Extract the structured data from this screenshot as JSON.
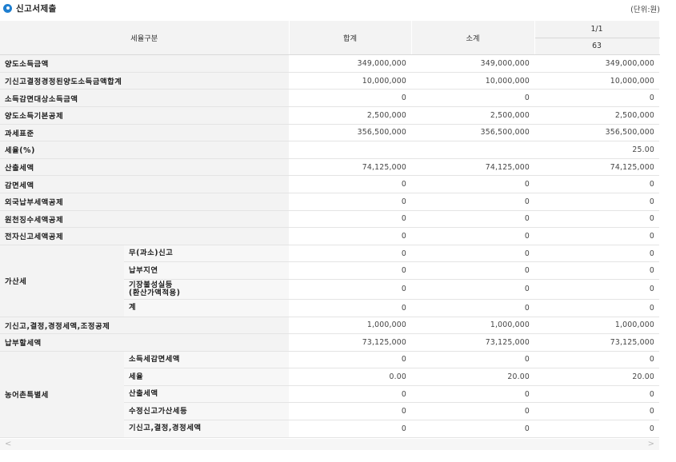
{
  "section": {
    "title": "신고서제출",
    "unit": "(단위:원)"
  },
  "header": {
    "category": "세율구분",
    "total": "합계",
    "subtotal": "소계",
    "period": "1/1",
    "period_sub": "63"
  },
  "rows": {
    "r1": {
      "label": "양도소득금액",
      "total": "349,000,000",
      "sub": "349,000,000",
      "col": "349,000,000"
    },
    "r2": {
      "label": "기신고결정경정된양도소득금액합계",
      "total": "10,000,000",
      "sub": "10,000,000",
      "col": "10,000,000"
    },
    "r3": {
      "label": "소득감면대상소득금액",
      "total": "0",
      "sub": "0",
      "col": "0"
    },
    "r4": {
      "label": "양도소득기본공제",
      "total": "2,500,000",
      "sub": "2,500,000",
      "col": "2,500,000"
    },
    "r5": {
      "label": "과세표준",
      "total": "356,500,000",
      "sub": "356,500,000",
      "col": "356,500,000"
    },
    "r6": {
      "label": "세율(%)",
      "total": "",
      "sub": "",
      "col": "25.00"
    },
    "r7": {
      "label": "산출세액",
      "total": "74,125,000",
      "sub": "74,125,000",
      "col": "74,125,000"
    },
    "r8": {
      "label": "감면세액",
      "total": "0",
      "sub": "0",
      "col": "0"
    },
    "r9": {
      "label": "외국납부세액공제",
      "total": "0",
      "sub": "0",
      "col": "0"
    },
    "r10": {
      "label": "원천징수세액공제",
      "total": "0",
      "sub": "0",
      "col": "0"
    },
    "r11": {
      "label": "전자신고세액공제",
      "total": "0",
      "sub": "0",
      "col": "0"
    },
    "g1": {
      "label": "가산세",
      "s1": {
        "label": "무(과소)신고",
        "total": "0",
        "sub": "0",
        "col": "0"
      },
      "s2": {
        "label": "납부지연",
        "total": "0",
        "sub": "0",
        "col": "0"
      },
      "s3": {
        "label1": "기장불성실등",
        "label2": "(환산가액적용)",
        "total": "0",
        "sub": "0",
        "col": "0"
      },
      "s4": {
        "label": "계",
        "total": "0",
        "sub": "0",
        "col": "0"
      }
    },
    "r12": {
      "label": "기신고,결정,경정세액,조정공제",
      "total": "1,000,000",
      "sub": "1,000,000",
      "col": "1,000,000"
    },
    "r13": {
      "label": "납부할세액",
      "total": "73,125,000",
      "sub": "73,125,000",
      "col": "73,125,000"
    },
    "g2": {
      "label": "농어촌특별세",
      "s1": {
        "label": "소득세감면세액",
        "total": "0",
        "sub": "0",
        "col": "0"
      },
      "s2": {
        "label": "세율",
        "total": "0.00",
        "sub": "20.00",
        "col": "20.00"
      },
      "s3": {
        "label": "산출세액",
        "total": "0",
        "sub": "0",
        "col": "0"
      },
      "s4": {
        "label": "수정신고가산세등",
        "total": "0",
        "sub": "0",
        "col": "0"
      },
      "s5": {
        "label": "기신고,결정,경정세액",
        "total": "0",
        "sub": "0",
        "col": "0"
      }
    }
  },
  "scrollbar": {
    "left": "<",
    "right": ">"
  },
  "icons": {
    "bullet": "circle-bullet-icon"
  },
  "colors": {
    "accent": "#1f7fd0",
    "header_bg": "#f3f3f3"
  }
}
